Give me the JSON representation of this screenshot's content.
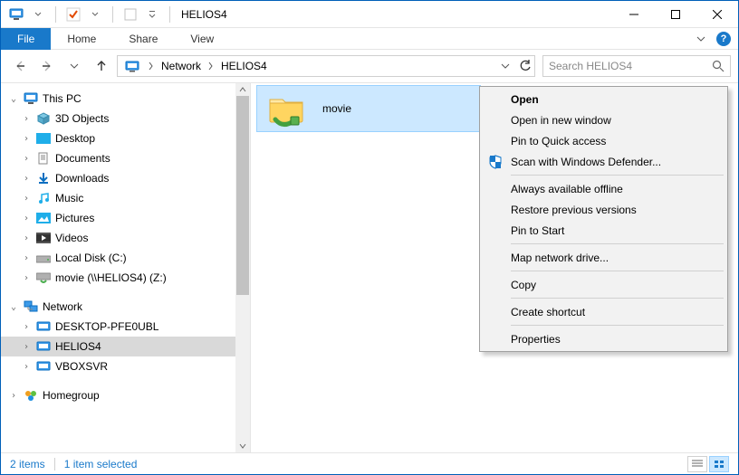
{
  "title": "HELIOS4",
  "ribbon": {
    "file": "File",
    "tabs": [
      "Home",
      "Share",
      "View"
    ]
  },
  "address": {
    "crumbs": [
      "Network",
      "HELIOS4"
    ]
  },
  "search": {
    "placeholder": "Search HELIOS4"
  },
  "tree": {
    "this_pc": "This PC",
    "items_pc": [
      "3D Objects",
      "Desktop",
      "Documents",
      "Downloads",
      "Music",
      "Pictures",
      "Videos",
      "Local Disk (C:)",
      "movie (\\\\HELIOS4) (Z:)"
    ],
    "network": "Network",
    "items_net": [
      "DESKTOP-PFE0UBL",
      "HELIOS4",
      "VBOXSVR"
    ],
    "homegroup": "Homegroup"
  },
  "content": {
    "items": [
      {
        "name": "movie"
      }
    ]
  },
  "context_menu": {
    "open": "Open",
    "open_new": "Open in new window",
    "pin_quick": "Pin to Quick access",
    "defender": "Scan with Windows Defender...",
    "always_offline": "Always available offline",
    "restore": "Restore previous versions",
    "pin_start": "Pin to Start",
    "map_drive": "Map network drive...",
    "copy": "Copy",
    "shortcut": "Create shortcut",
    "properties": "Properties"
  },
  "status": {
    "count": "2 items",
    "selected": "1 item selected"
  }
}
